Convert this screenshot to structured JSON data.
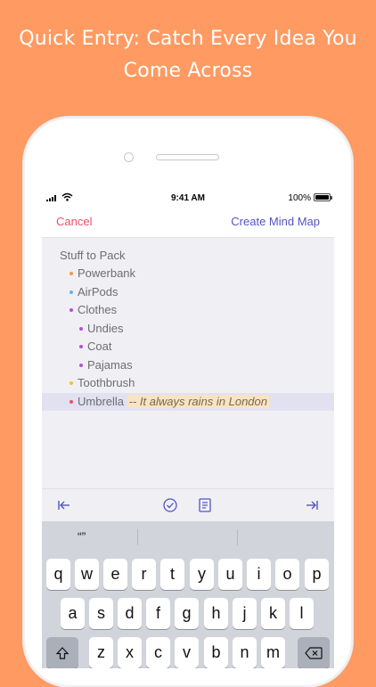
{
  "headline": {
    "line1": "Quick Entry: Catch Every Idea You",
    "line2": "Come Across"
  },
  "status_bar": {
    "time": "9:41 AM",
    "battery": "100%"
  },
  "nav": {
    "cancel": "Cancel",
    "create": "Create Mind Map"
  },
  "outline": [
    {
      "text": "Stuff to Pack",
      "level": 0,
      "bullet_color": ""
    },
    {
      "text": "Powerbank",
      "level": 1,
      "bullet_color": "#F39A4C"
    },
    {
      "text": "AirPods",
      "level": 1,
      "bullet_color": "#61B6F2"
    },
    {
      "text": "Clothes",
      "level": 1,
      "bullet_color": "#B253CF"
    },
    {
      "text": "Undies",
      "level": 2,
      "bullet_color": "#B253CF"
    },
    {
      "text": "Coat",
      "level": 2,
      "bullet_color": "#B253CF"
    },
    {
      "text": "Pajamas",
      "level": 2,
      "bullet_color": "#B253CF"
    },
    {
      "text": "Toothbrush",
      "level": 1,
      "bullet_color": "#F4C130"
    },
    {
      "text": "Umbrella",
      "level": 1,
      "bullet_color": "#E8526A",
      "note": "-- It always rains in London",
      "selected": true
    }
  ],
  "toolbar": {
    "icons": [
      "outdent-icon",
      "checkbox-icon",
      "note-icon",
      "indent-icon"
    ]
  },
  "keyboard": {
    "suggestion": "“”",
    "row1": [
      "q",
      "w",
      "e",
      "r",
      "t",
      "y",
      "u",
      "i",
      "o",
      "p"
    ],
    "row2": [
      "a",
      "s",
      "d",
      "f",
      "g",
      "h",
      "j",
      "k",
      "l"
    ],
    "row3": [
      "z",
      "x",
      "c",
      "v",
      "b",
      "n",
      "m"
    ]
  },
  "colors": {
    "background": "#FE9A62",
    "accent": "#5453C4",
    "cancel": "#E8526A"
  }
}
